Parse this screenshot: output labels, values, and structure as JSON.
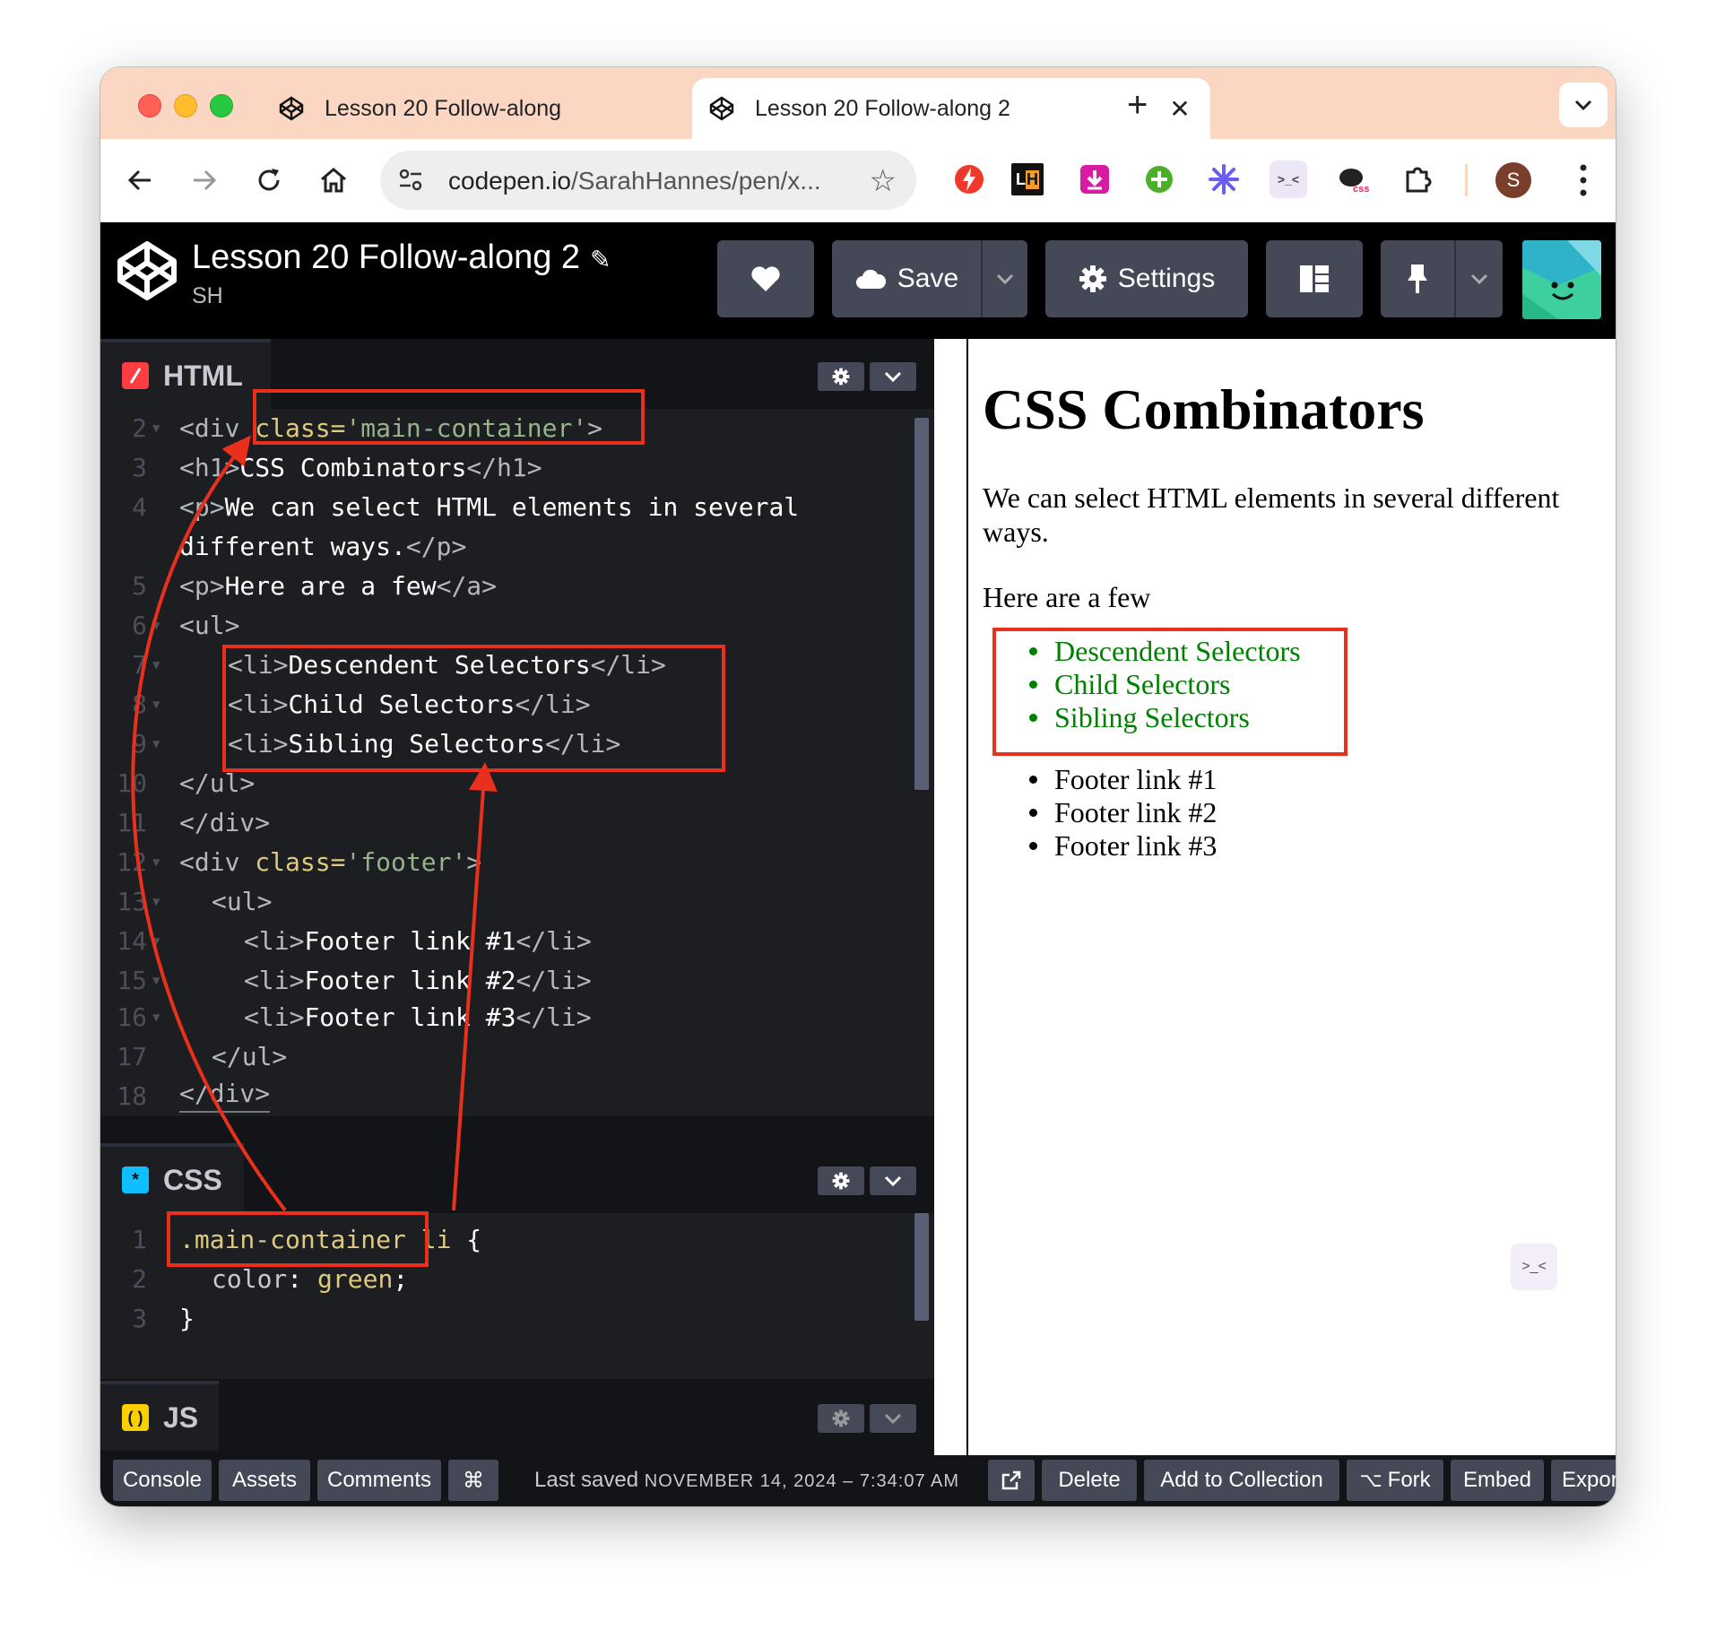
{
  "browser": {
    "tabs": [
      {
        "label": "Lesson 20 Follow-along",
        "active": false
      },
      {
        "label": "Lesson 20 Follow-along 2",
        "active": true
      }
    ],
    "address": {
      "domain": "codepen.io",
      "path": "/SarahHannes/pen/x..."
    },
    "profile_initial": "S",
    "extensions": [
      "lightning-extension-icon",
      "lh-extension-icon",
      "download-extension-icon",
      "plus-extension-icon",
      "asterisk-extension-icon",
      "terminal-extension-icon",
      "css-kiwi-extension-icon",
      "puzzle-extension-icon"
    ]
  },
  "codepen": {
    "title": "Lesson 20 Follow-along 2",
    "user": "SH",
    "buttons": {
      "save": "Save",
      "settings": "Settings"
    }
  },
  "editors": {
    "html": {
      "label": "HTML",
      "badge_color": "#ff3c41",
      "lines": [
        {
          "n": "2",
          "text": "<div class='main-container'>"
        },
        {
          "n": "3",
          "text": "<h1>CSS Combinators</h1>"
        },
        {
          "n": "4",
          "text": "<p>We can select HTML elements in several"
        },
        {
          "n": "",
          "text": "different ways.</p>"
        },
        {
          "n": "5",
          "text": "<p>Here are a few</a>"
        },
        {
          "n": "6",
          "text": "<ul>"
        },
        {
          "n": "7",
          "text": "   <li>Descendent Selectors</li>"
        },
        {
          "n": "8",
          "text": "   <li>Child Selectors</li>"
        },
        {
          "n": "9",
          "text": "   <li>Sibling Selectors</li>"
        },
        {
          "n": "10",
          "text": "</ul>"
        },
        {
          "n": "11",
          "text": "</div>"
        },
        {
          "n": "12",
          "text": "<div class='footer'>"
        },
        {
          "n": "13",
          "text": "  <ul>"
        },
        {
          "n": "14",
          "text": "    <li>Footer link #1</li>"
        },
        {
          "n": "15",
          "text": "    <li>Footer link #2</li>"
        },
        {
          "n": "16",
          "text": "    <li>Footer link #3</li>"
        },
        {
          "n": "17",
          "text": "  </ul>"
        },
        {
          "n": "18",
          "text": "</div>"
        }
      ]
    },
    "css": {
      "label": "CSS",
      "badge_color": "#0ebeff",
      "lines": [
        {
          "n": "1",
          "text": ".main-container li {"
        },
        {
          "n": "2",
          "text": "  color: green;"
        },
        {
          "n": "3",
          "text": "}"
        }
      ]
    },
    "js": {
      "label": "JS",
      "badge_color": "#fcd000"
    }
  },
  "footer": {
    "buttons": {
      "console": "Console",
      "assets": "Assets",
      "comments": "Comments",
      "shortcut": "⌘",
      "delete": "Delete",
      "add_to_collection": "Add to Collection",
      "fork": "Fork",
      "embed": "Embed",
      "export": "Expor"
    },
    "last_saved_label": "Last saved",
    "last_saved_time": "NOVEMBER 14, 2024 – 7:34:07 AM"
  },
  "preview": {
    "heading": "CSS Combinators",
    "paragraph": "We can select HTML elements in several different ways.",
    "paragraph2": "Here are a few",
    "main_list": [
      "Descendent Selectors",
      "Child Selectors",
      "Sibling Selectors"
    ],
    "footer_list": [
      "Footer link #1",
      "Footer link #2",
      "Footer link #3"
    ],
    "main_list_color": "#008000"
  },
  "annotation_color": "#e8301c"
}
